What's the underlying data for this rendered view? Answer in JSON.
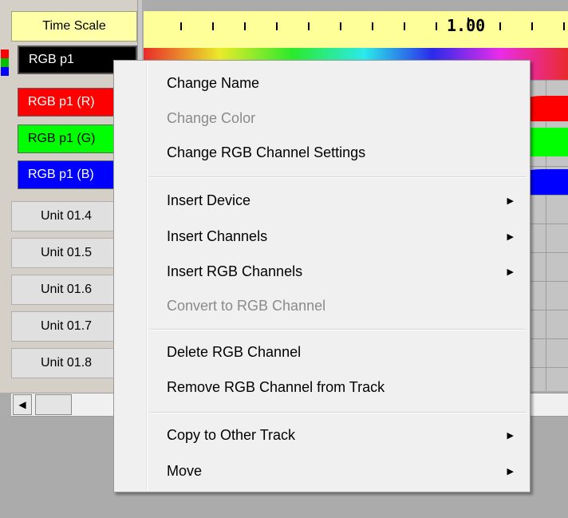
{
  "track": {
    "time_scale_label": "Time Scale",
    "channels": [
      {
        "label": "RGB p1",
        "bg": "#000000",
        "fg": "#ffffff"
      },
      {
        "label": "RGB p1 (R)",
        "bg": "#ff0000",
        "fg": "#ffffff"
      },
      {
        "label": "RGB p1 (G)",
        "bg": "#00ff00",
        "fg": "#000000"
      },
      {
        "label": "RGB p1 (B)",
        "bg": "#0000ff",
        "fg": "#ffffff"
      }
    ],
    "units": [
      "Unit 01.4",
      "Unit 01.5",
      "Unit 01.6",
      "Unit 01.7",
      "Unit 01.8"
    ],
    "ruler_label": "1.00",
    "swatch_colors": [
      "#ff0000",
      "#00c000",
      "#0000ff"
    ]
  },
  "context_menu": {
    "items": [
      {
        "label": "Change Name",
        "enabled": true,
        "submenu": false
      },
      {
        "label": "Change Color",
        "enabled": false,
        "submenu": false
      },
      {
        "label": "Change RGB Channel Settings",
        "enabled": true,
        "submenu": false
      },
      {
        "label": "Insert Device",
        "enabled": true,
        "submenu": true
      },
      {
        "label": "Insert Channels",
        "enabled": true,
        "submenu": true
      },
      {
        "label": "Insert RGB Channels",
        "enabled": true,
        "submenu": true
      },
      {
        "label": "Convert to RGB Channel",
        "enabled": false,
        "submenu": false
      },
      {
        "label": "Delete RGB Channel",
        "enabled": true,
        "submenu": false
      },
      {
        "label": "Remove RGB Channel from Track",
        "enabled": true,
        "submenu": false
      },
      {
        "label": "Copy to Other Track",
        "enabled": true,
        "submenu": true
      },
      {
        "label": "Move",
        "enabled": true,
        "submenu": true
      }
    ]
  }
}
